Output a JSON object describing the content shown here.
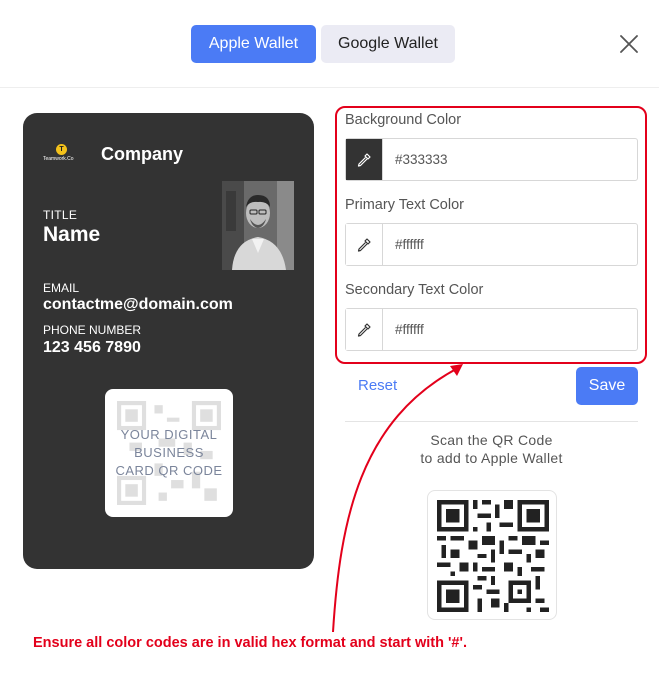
{
  "tabs": {
    "apple": "Apple Wallet",
    "google": "Google Wallet"
  },
  "card": {
    "logo_text": "Teamwork.Co",
    "logo_letter": "T",
    "company": "Company",
    "title_label": "TITLE",
    "name": "Name",
    "email_label": "EMAIL",
    "email": "contactme@domain.com",
    "phone_label": "PHONE NUMBER",
    "phone": "123 456 7890",
    "qr_placeholder": "YOUR DIGITAL BUSINESS CARD QR CODE"
  },
  "form": {
    "background": {
      "label": "Background Color",
      "value": "#333333"
    },
    "primary": {
      "label": "Primary Text Color",
      "value": "#ffffff"
    },
    "secondary": {
      "label": "Secondary Text Color",
      "value": "#ffffff"
    },
    "reset_label": "Reset",
    "save_label": "Save"
  },
  "scan": {
    "line1": "Scan the QR Code",
    "line2": "to add to Apple Wallet"
  },
  "annotation": "Ensure all color codes are in valid hex format and start with '#'.",
  "colors": {
    "accent": "#4b7bf5",
    "card_bg": "#333333",
    "highlight": "#e3001b"
  }
}
